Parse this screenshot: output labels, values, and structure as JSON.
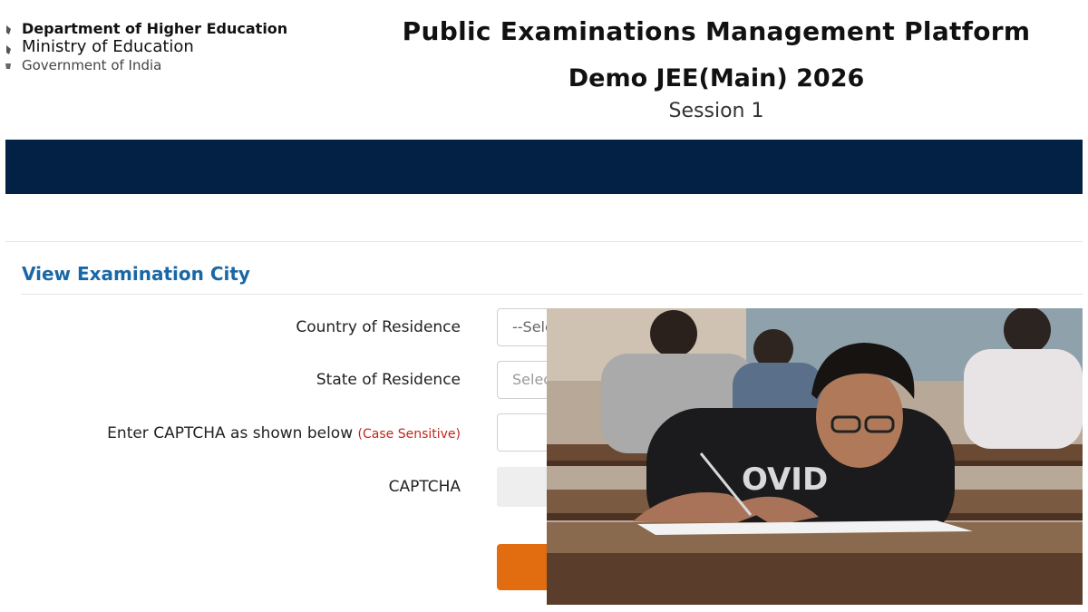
{
  "header": {
    "department": "Department of Higher Education",
    "ministry": "Ministry of Education",
    "government": "Government of India",
    "platform_title": "Public Examinations Management Platform",
    "exam_title": "Demo JEE(Main) 2026",
    "session": "Session 1"
  },
  "form": {
    "section_title": "View Examination City",
    "country_label": "Country of Residence",
    "country_value": "--Select--",
    "state_label": "State of Residence",
    "state_placeholder": "Select",
    "captcha_entry_label": "Enter CAPTCHA as shown below",
    "case_note": "(Case Sensitive)",
    "captcha_label": "CAPTCHA"
  },
  "colors": {
    "navbar": "#022145",
    "section_title": "#1a67a6",
    "submit_button": "#e26d10",
    "case_note": "#c0261b"
  },
  "icons": [
    "national-emblem-icon"
  ]
}
